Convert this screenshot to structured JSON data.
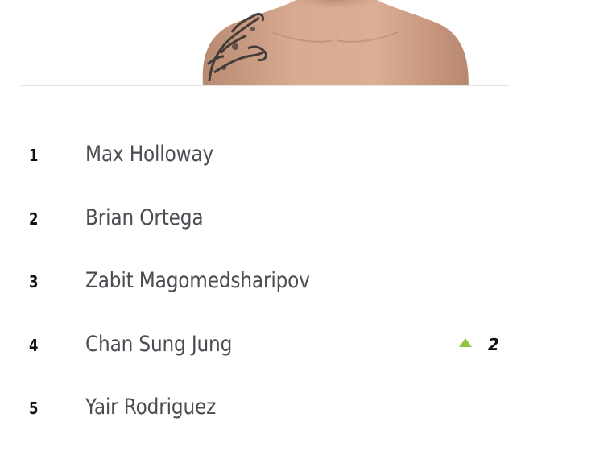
{
  "champion": {
    "image": "champion-fighter-photo"
  },
  "rankings": [
    {
      "rank": "1",
      "name": "Max Holloway",
      "movement": null
    },
    {
      "rank": "2",
      "name": "Brian Ortega",
      "movement": null
    },
    {
      "rank": "3",
      "name": "Zabit Magomedsharipov",
      "movement": null
    },
    {
      "rank": "4",
      "name": "Chan Sung Jung",
      "movement": {
        "direction": "up",
        "icon": "up-arrow-icon",
        "value": "2",
        "color": "#8dc63f"
      }
    },
    {
      "rank": "5",
      "name": "Yair Rodriguez",
      "movement": null
    }
  ]
}
